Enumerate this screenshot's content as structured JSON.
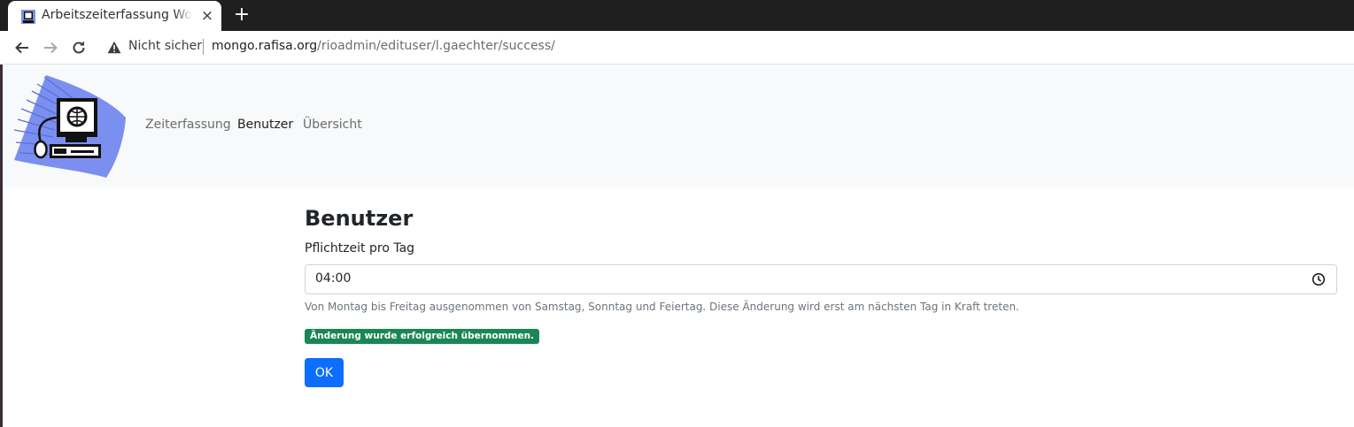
{
  "browser": {
    "tab_title": "Arbeitszeiterfassung Wohn",
    "tab_close": "×",
    "new_tab": "+",
    "security_label": "Nicht sicher",
    "url_host": "mongo.rafisa.org",
    "url_path": "/rioadmin/edituser/l.gaechter/success/"
  },
  "navbar": {
    "items": [
      {
        "label": "Zeiterfassung",
        "active": false
      },
      {
        "label": "Benutzer",
        "active": true
      },
      {
        "label": "Übersicht",
        "active": false
      }
    ]
  },
  "main": {
    "title": "Benutzer",
    "field_label": "Pflichtzeit pro Tag",
    "time_value": "04:00",
    "help_text": "Von Montag bis Freitag ausgenommen von Samstag, Sonntag und Feiertag. Diese Änderung wird erst am nächsten Tag in Kraft treten.",
    "success_message": "Änderung wurde erfolgreich übernommen.",
    "ok_label": "OK"
  },
  "colors": {
    "primary": "#0d6efd",
    "success": "#198754",
    "navbar_bg": "#f8f9fa"
  }
}
